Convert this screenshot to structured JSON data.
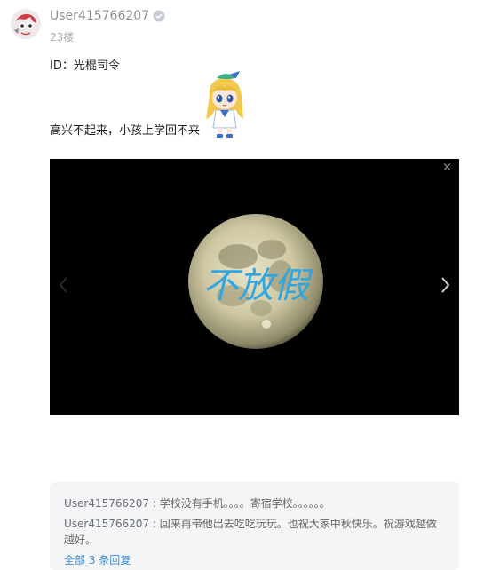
{
  "post": {
    "username": "User415766207",
    "floor": "23楼",
    "line1": "ID：光棍司令",
    "line2": "高兴不起来，小孩上学回不来",
    "image": {
      "overlay_text": "不放假",
      "close_glyph": "×"
    }
  },
  "replies": {
    "items": [
      {
        "user": "User415766207",
        "sep": " : ",
        "text": "学校没有手机。。。。寄宿学校。。。。。。"
      },
      {
        "user": "User415766207",
        "sep": " : ",
        "text": "回来再带他出去吃吃玩玩。也祝大家中秋快乐。祝游戏越做越好。"
      }
    ],
    "more_label": "全部 3 条回复"
  },
  "colors": {
    "link": "#3a8fd9",
    "overlay_text": "#2fa6e0",
    "replies_bg": "#f4f5f7"
  },
  "icons": {
    "avatar": "avatar",
    "badge": "verified-badge-icon",
    "sticker": "anime-girl-sticker",
    "prev": "chevron-left-icon",
    "next": "chevron-right-icon",
    "close": "close-icon"
  }
}
